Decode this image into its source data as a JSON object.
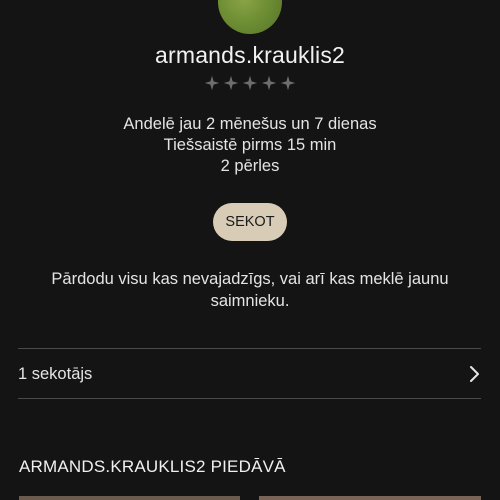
{
  "profile": {
    "username": "armands.krauklis2",
    "rating_stars": 5,
    "rating_value": 0,
    "meta": [
      "Andelē jau 2 mēnešus un 7 dienas",
      "Tiešsaistē pirms 15 min",
      "2 pērles"
    ],
    "follow_label": "SEKOT",
    "bio": "Pārdodu visu kas nevajadzīgs, vai arī kas meklē jaunu saimnieku."
  },
  "followers": {
    "label": "1 sekotājs"
  },
  "listings": {
    "title": "ARMANDS.KRAUKLIS2 PIEDĀVĀ"
  },
  "colors": {
    "background": "#141414",
    "button": "#d8ccb6",
    "star_empty": "#6e6e6e",
    "divider": "#4a4a4a"
  },
  "icons": {
    "rating": "star-icon",
    "row_arrow": "chevron-right-icon"
  }
}
